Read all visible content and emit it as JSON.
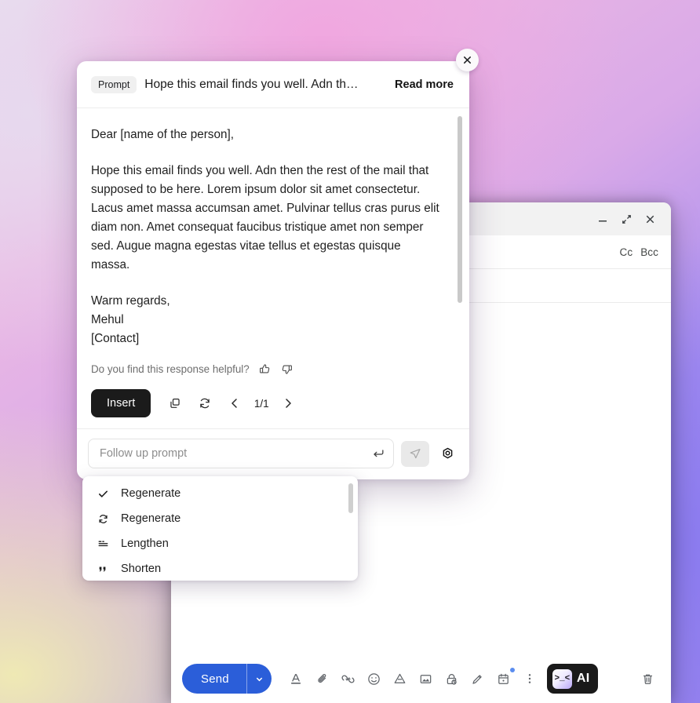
{
  "theme": {
    "accent_dark": "#1b1b1b",
    "gmail_blue": "#2b5ed9",
    "panel_bg": "#ffffff",
    "badge_bg": "#f0f0f0",
    "muted_text": "#6e6e6e"
  },
  "gmail_window": {
    "titlebar": {
      "minimize_label": "minimize",
      "expand_label": "expand",
      "close_label": "close"
    },
    "recipients": {
      "cc_label": "Cc",
      "bcc_label": "Bcc"
    },
    "toolbar": {
      "send_label": "Send",
      "send_dropdown_label": "more send options",
      "icons": [
        {
          "name": "formatting-options-icon",
          "title": "Formatting options"
        },
        {
          "name": "attach-file-icon",
          "title": "Attach files"
        },
        {
          "name": "insert-link-icon",
          "title": "Insert link"
        },
        {
          "name": "insert-emoji-icon",
          "title": "Insert emoji"
        },
        {
          "name": "insert-drive-icon",
          "title": "Insert files using Drive"
        },
        {
          "name": "insert-photo-icon",
          "title": "Insert photo"
        },
        {
          "name": "confidential-mode-icon",
          "title": "Toggle confidential mode"
        },
        {
          "name": "insert-signature-icon",
          "title": "Insert signature"
        },
        {
          "name": "schedule-send-icon",
          "title": "Set up a time to send"
        },
        {
          "name": "more-options-icon",
          "title": "More options"
        }
      ],
      "ai_button": {
        "glyph": ">_<",
        "label": "AI"
      },
      "discard_label": "Discard draft"
    }
  },
  "ai_panel": {
    "close_label": "Close",
    "header": {
      "badge": "Prompt",
      "prompt_preview": "Hope this email finds you well. Adn th…",
      "read_more": "Read more"
    },
    "response": {
      "salutation": "Dear [name of the person],",
      "paragraph": "Hope this email finds you well. Adn then the rest of the mail that supposed to be here. Lorem ipsum dolor sit amet consectetur. Lacus amet massa accumsan amet. Pulvinar tellus cras purus elit diam non. Amet consequat faucibus tristique amet non semper sed. Augue magna egestas vitae tellus et egestas quisque massa.",
      "signoff": "Warm regards,",
      "sender_name": "Mehul",
      "contact_placeholder": "[Contact]"
    },
    "feedback": {
      "label": "Do you find this response helpful?",
      "thumbs_up": "thumbs-up",
      "thumbs_down": "thumbs-down"
    },
    "actions": {
      "insert_label": "Insert",
      "copy_label": "Copy",
      "regenerate_label": "Regenerate",
      "prev_label": "Previous",
      "next_label": "Next",
      "page_indicator": "1/1"
    },
    "followup": {
      "value": "",
      "placeholder": "Follow up prompt",
      "enter_hint": "enter",
      "send_label": "Send prompt",
      "settings_label": "Settings"
    }
  },
  "dropdown_menu": {
    "items": [
      {
        "icon": "check-icon",
        "label": "Regenerate",
        "selected": true
      },
      {
        "icon": "refresh-icon",
        "label": "Regenerate",
        "selected": false
      },
      {
        "icon": "lengthen-icon",
        "label": "Lengthen",
        "selected": false
      },
      {
        "icon": "quote-icon",
        "label": "Shorten",
        "selected": false
      }
    ]
  }
}
